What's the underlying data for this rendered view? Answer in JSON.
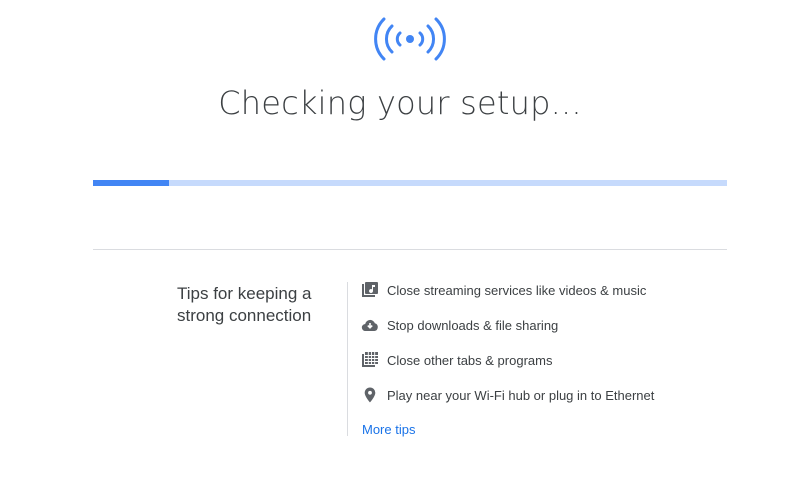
{
  "header": {
    "icon": "wireless-signal-icon",
    "title": "Checking your setup..."
  },
  "progress": {
    "value_percent": 12
  },
  "tips": {
    "heading": "Tips for keeping a strong connection",
    "items": [
      {
        "icon": "video-library-icon",
        "label": "Close streaming services like videos & music"
      },
      {
        "icon": "cloud-download-icon",
        "label": "Stop downloads & file sharing"
      },
      {
        "icon": "grid-tabs-icon",
        "label": "Close other tabs & programs"
      },
      {
        "icon": "location-pin-icon",
        "label": "Play near your Wi-Fi hub or plug in to Ethernet"
      }
    ],
    "more_link": "More tips"
  },
  "colors": {
    "accent": "#4285f4",
    "track": "#c6dafc",
    "link": "#1a73e8",
    "icon": "#5f6368",
    "text": "#3c4043"
  }
}
